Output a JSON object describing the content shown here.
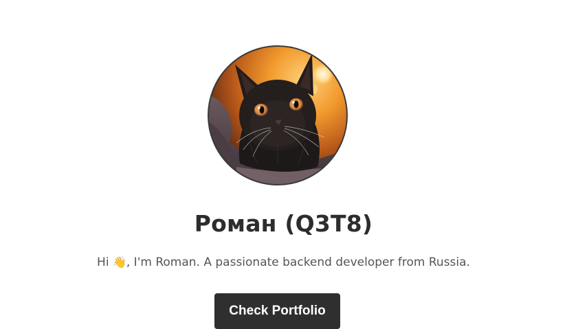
{
  "profile": {
    "avatar_icon": "cat-photo-icon",
    "name": "Роман (Q3T8)",
    "bio": {
      "prefix": "Hi ",
      "emoji": "👋",
      "text": ", I'm Roman. A passionate backend developer from Russia."
    },
    "button_label": "Check Portfolio"
  },
  "colors": {
    "background": "#ffffff",
    "button": "#2f2f2f",
    "button_text": "#ffffff",
    "name_text": "#2d2d2d",
    "bio_text": "#555555"
  }
}
